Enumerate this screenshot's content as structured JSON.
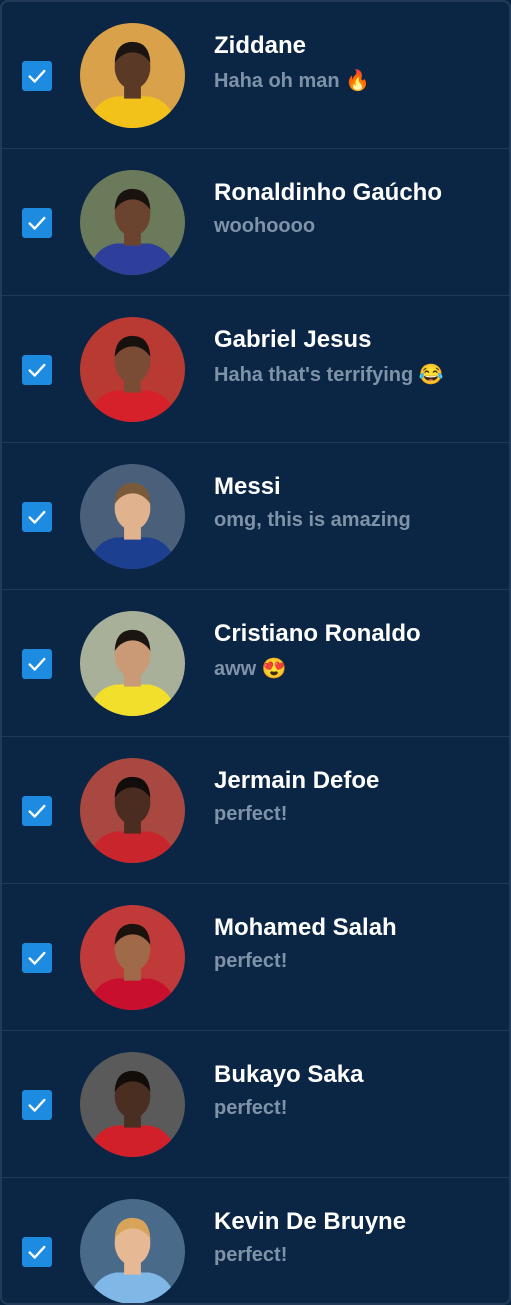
{
  "contacts": [
    {
      "name": "Ziddane",
      "message": "Haha oh man 🔥",
      "checked": true,
      "avatar": {
        "bg": "#d9a24a",
        "skin": "#5a3a26",
        "hair": "#1b1410",
        "shirt": "#f2c21a"
      }
    },
    {
      "name": "Ronaldinho Gaúcho",
      "message": "woohoooo",
      "checked": true,
      "avatar": {
        "bg": "#6b7a5a",
        "skin": "#6b4430",
        "hair": "#1a120e",
        "shirt": "#2d3f9a"
      }
    },
    {
      "name": "Gabriel Jesus",
      "message": "Haha that's terrifying 😂",
      "checked": true,
      "avatar": {
        "bg": "#b83a32",
        "skin": "#7a4c35",
        "hair": "#17110d",
        "shirt": "#d6202a"
      }
    },
    {
      "name": "Messi",
      "message": "omg, this is amazing",
      "checked": true,
      "avatar": {
        "bg": "#4a5f7a",
        "skin": "#e1b28e",
        "hair": "#7a5a38",
        "shirt": "#1c3f8f"
      }
    },
    {
      "name": "Cristiano Ronaldo",
      "message": "aww 😍",
      "checked": true,
      "avatar": {
        "bg": "#a8b09a",
        "skin": "#c99a75",
        "hair": "#1c1410",
        "shirt": "#f1df2b"
      }
    },
    {
      "name": "Jermain Defoe",
      "message": "perfect!",
      "checked": true,
      "avatar": {
        "bg": "#a84840",
        "skin": "#4a2c20",
        "hair": "#120c0a",
        "shirt": "#c9252c"
      }
    },
    {
      "name": "Mohamed Salah",
      "message": "perfect!",
      "checked": true,
      "avatar": {
        "bg": "#c03a3a",
        "skin": "#a06a4a",
        "hair": "#1b120e",
        "shirt": "#c8102e"
      }
    },
    {
      "name": "Bukayo Saka",
      "message": "perfect!",
      "checked": true,
      "avatar": {
        "bg": "#5a5a5a",
        "skin": "#4a2e22",
        "hair": "#130d0a",
        "shirt": "#d2202b"
      }
    },
    {
      "name": "Kevin De Bruyne",
      "message": "perfect!",
      "checked": true,
      "avatar": {
        "bg": "#4a6a8a",
        "skin": "#e7b894",
        "hair": "#d8a45a",
        "shirt": "#7fb8e6"
      }
    }
  ]
}
